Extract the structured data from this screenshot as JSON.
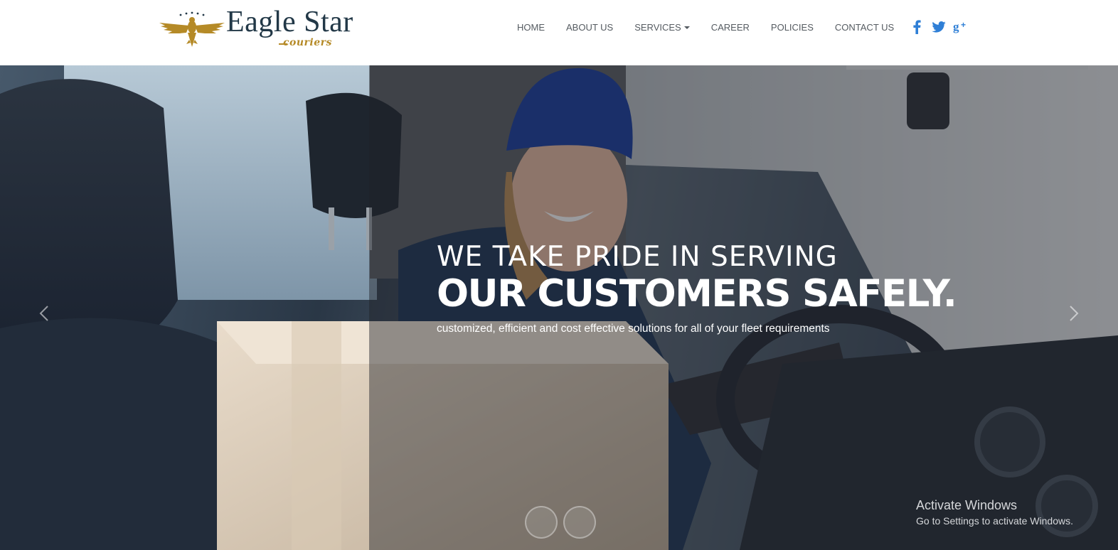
{
  "brand": {
    "name": "Eagle Star",
    "subtitle": "couriers",
    "gold": "#b58a27",
    "navy": "#223847"
  },
  "nav": {
    "items": [
      "HOME",
      "ABOUT US",
      "SERVICES",
      "CAREER",
      "POLICIES",
      "CONTACT US"
    ],
    "services_has_dropdown": true,
    "text_color": "#555b61"
  },
  "social": {
    "icons": [
      "facebook-icon",
      "twitter-icon",
      "google-plus-icon"
    ],
    "facebook_glyph": "f",
    "google_glyph": "g+",
    "color": "#2f7fd6"
  },
  "hero": {
    "line1": "WE TAKE PRIDE IN SERVING",
    "line2": "OUR CUSTOMERS SAFELY.",
    "description": "customized, efficient and cost effective solutions for all of your fleet requirements",
    "prev_icon": "chevron-left-icon",
    "next_icon": "chevron-right-icon",
    "slide_thumbs": 2
  },
  "watermark": {
    "title": "Activate Windows",
    "subtitle": "Go to Settings to activate Windows."
  }
}
